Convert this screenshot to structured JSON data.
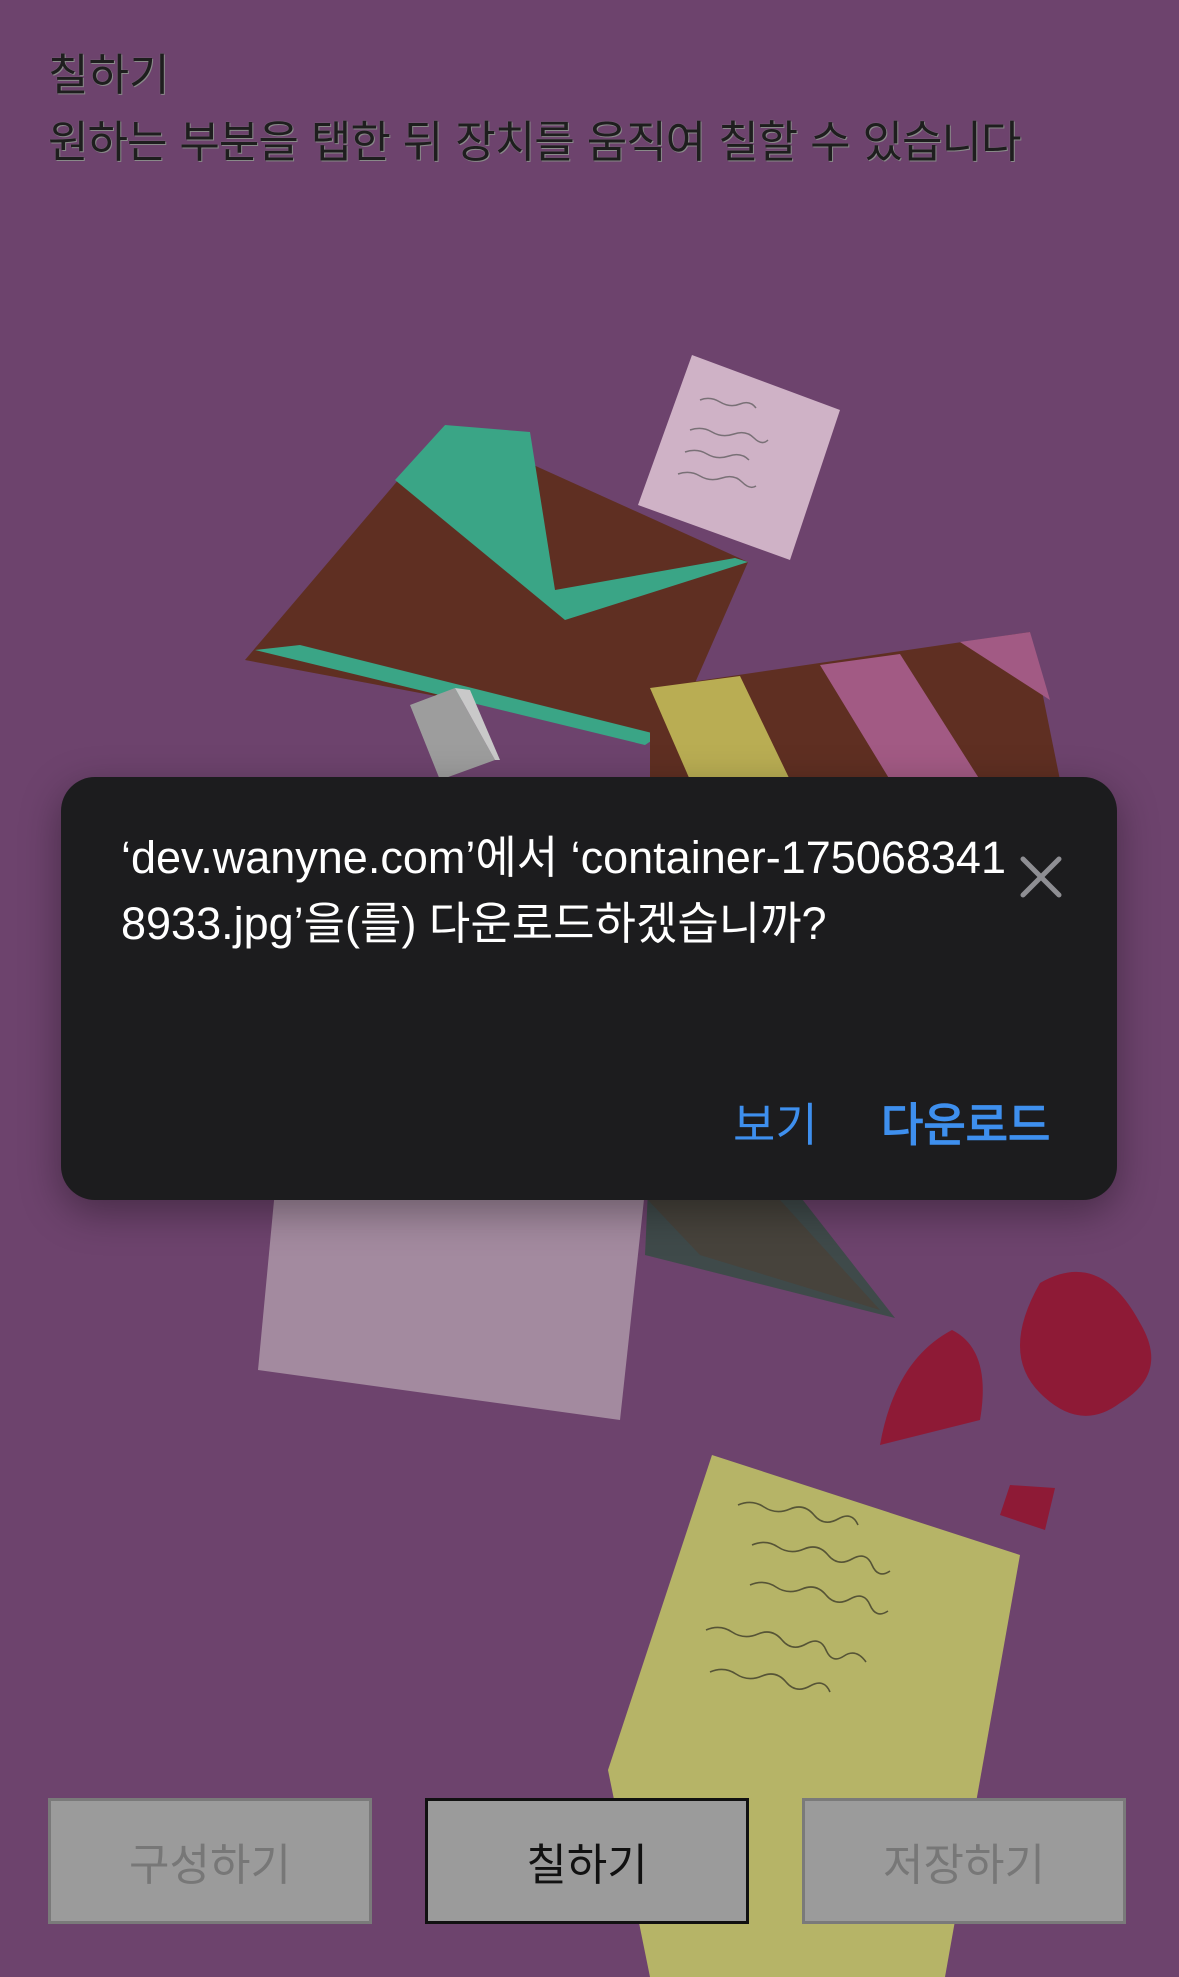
{
  "header": {
    "title": "칠하기",
    "subtitle": "원하는 부분을 탭한 뒤 장치를 움직여 칠할 수 있습니다"
  },
  "dialog": {
    "message": "‘dev.wanyne.com’에서 ‘container-1750683418933.jpg’을(를) 다운로드하겠습니까?",
    "close_icon": "close-icon",
    "view_label": "보기",
    "download_label": "다운로드"
  },
  "toolbar": {
    "compose_label": "구성하기",
    "paint_label": "칠하기",
    "save_label": "저장하기"
  },
  "colors": {
    "background": "#6d436d",
    "dialog_bg": "#1c1c1e",
    "accent": "#3e8fee",
    "button_bg": "#9b9b9b"
  }
}
